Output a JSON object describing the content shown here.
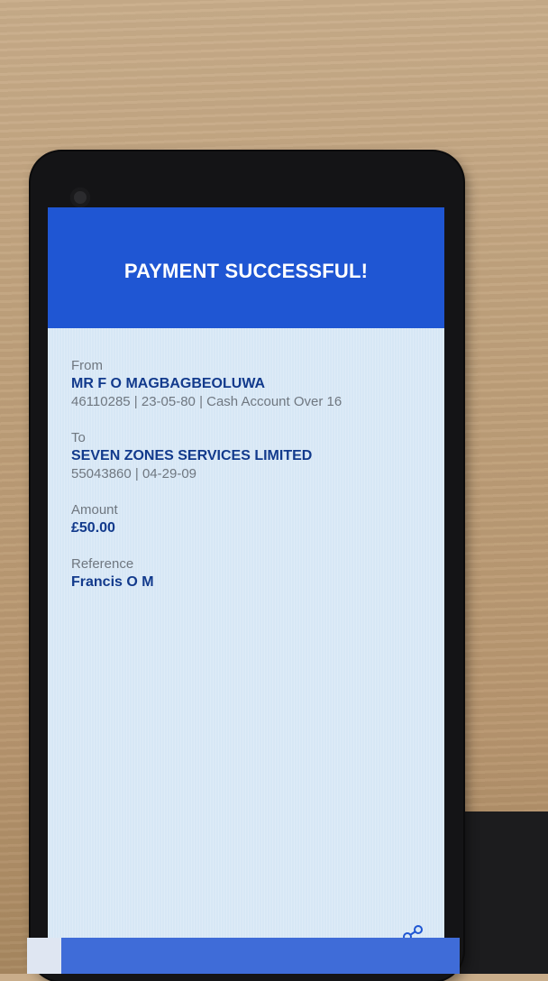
{
  "header": {
    "title": "PAYMENT SUCCESSFUL!"
  },
  "from": {
    "label": "From",
    "name": "MR F O MAGBAGBEOLUWA",
    "details": "46110285 | 23-05-80 | Cash Account Over 16"
  },
  "to": {
    "label": "To",
    "name": "SEVEN ZONES SERVICES LIMITED",
    "details": "55043860 | 04-29-09"
  },
  "amount": {
    "label": "Amount",
    "value": "£50.00"
  },
  "reference": {
    "label": "Reference",
    "value": "Francis O M"
  },
  "icons": {
    "share": "share-icon"
  },
  "colors": {
    "header": "#1f56d3",
    "value_text": "#123a8c",
    "label_text": "#6f7780",
    "screen_bg": "#d7e7f5"
  }
}
